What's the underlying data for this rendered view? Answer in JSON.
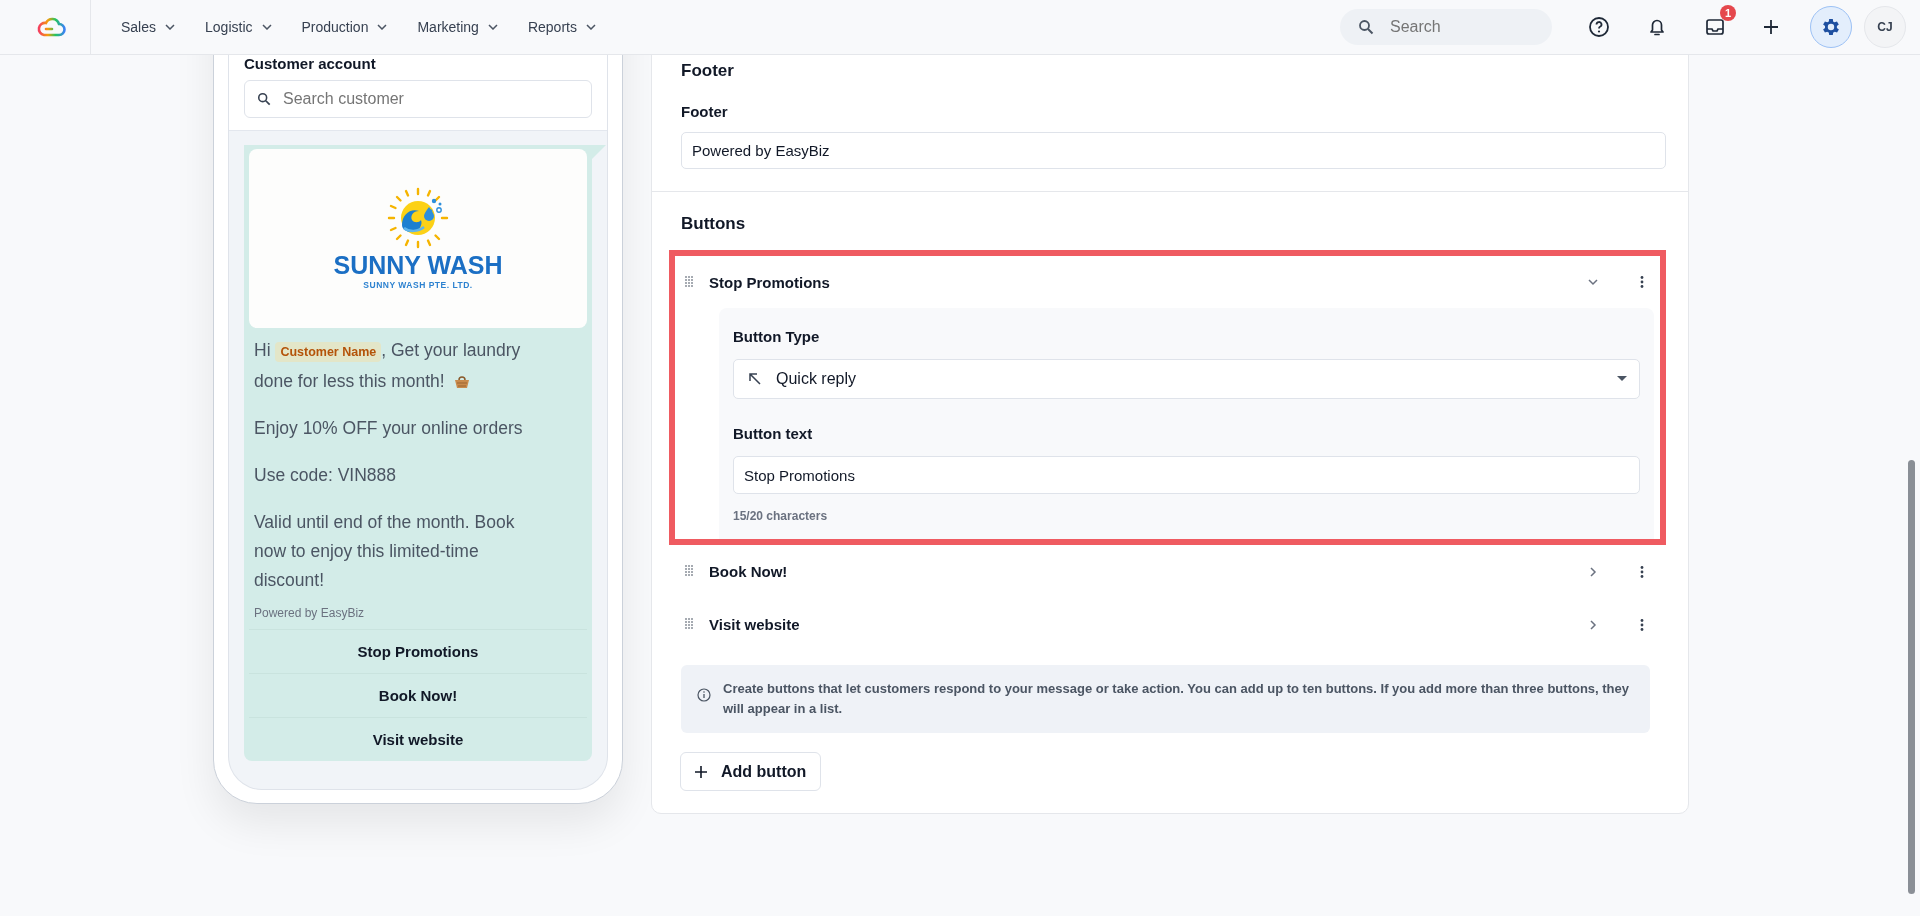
{
  "top_nav": {
    "menus": [
      {
        "label": "Sales"
      },
      {
        "label": "Logistic"
      },
      {
        "label": "Production"
      },
      {
        "label": "Marketing"
      },
      {
        "label": "Reports"
      }
    ],
    "search": {
      "placeholder": "Search"
    },
    "inbox_badge": "1",
    "avatar": "CJ"
  },
  "preview": {
    "section_title": "Customer account",
    "search": {
      "placeholder": "Search customer"
    },
    "logo": {
      "title": "SUNNY WASH",
      "subtitle": "SUNNY WASH PTE. LTD."
    },
    "greeting": {
      "before": "Hi",
      "variable": "Customer Name",
      "after": ", Get your laundry done for less this month!"
    },
    "paragraphs": [
      "Enjoy 10% OFF your online orders",
      "Use code: VIN888",
      "Valid until end of the month. Book now to enjoy this limited-time discount!"
    ],
    "footer": "Powered by EasyBiz",
    "buttons": [
      "Stop Promotions",
      "Book Now!",
      "Visit website"
    ]
  },
  "editor": {
    "footer": {
      "heading": "Footer",
      "label": "Footer",
      "value": "Powered by EasyBiz"
    },
    "buttons": {
      "heading": "Buttons",
      "items": [
        {
          "title": "Stop Promotions",
          "expanded": true,
          "highlighted": true,
          "type_label": "Button Type",
          "type_value": "Quick reply",
          "text_label": "Button text",
          "text_value": "Stop Promotions",
          "counter": "15/20 characters"
        },
        {
          "title": "Book Now!",
          "expanded": false,
          "highlighted": false
        },
        {
          "title": "Visit website",
          "expanded": false,
          "highlighted": false
        }
      ],
      "info": "Create buttons that let customers respond to your message or take action. You can add up to ten buttons. If you add more than three buttons, they will appear in a list.",
      "add_label": "Add button"
    }
  }
}
